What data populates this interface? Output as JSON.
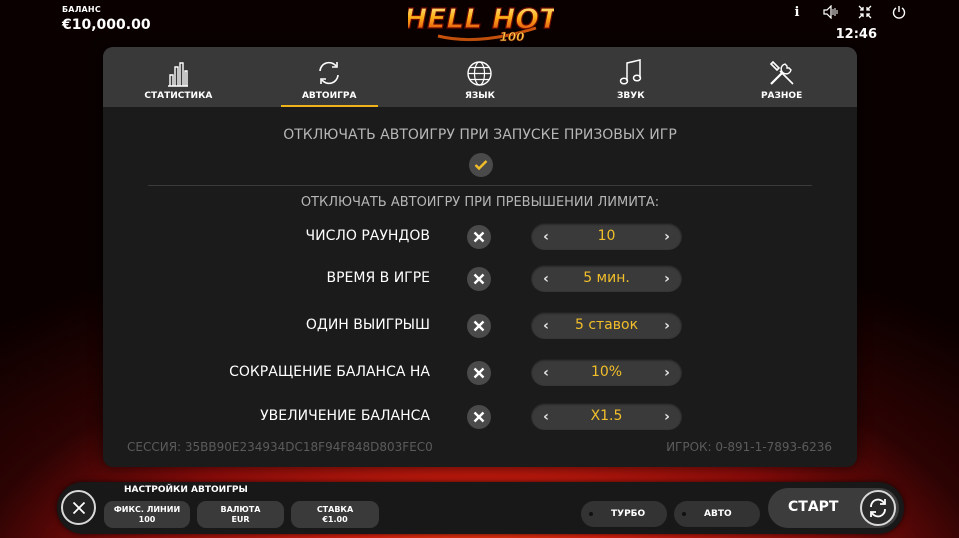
{
  "header": {
    "balance_label": "БАЛАНС",
    "balance_value": "€10,000.00",
    "logo_text": "HELL HOT",
    "logo_sub": "100",
    "info_icon_text": "i",
    "clock": "12:46"
  },
  "tabs": [
    {
      "label": "СТАТИСТИКА",
      "icon": "bar-chart-icon",
      "active": false
    },
    {
      "label": "АВТОИГРА",
      "icon": "refresh-icon",
      "active": true
    },
    {
      "label": "ЯЗЫК",
      "icon": "globe-icon",
      "active": false
    },
    {
      "label": "ЗВУК",
      "icon": "music-note-icon",
      "active": false
    },
    {
      "label": "РАЗНОЕ",
      "icon": "tools-icon",
      "active": false
    }
  ],
  "autoplay": {
    "prize_title": "ОТКЛЮЧАТЬ АВТОИГРУ ПРИ ЗАПУСКЕ ПРИЗОВЫХ ИГР",
    "prize_checked": true,
    "limit_title": "ОТКЛЮЧАТЬ АВТОИГРУ ПРИ ПРЕВЫШЕНИИ ЛИМИТА:",
    "rows": [
      {
        "label": "ЧИСЛО РАУНДОВ",
        "value": "10",
        "enabled": false
      },
      {
        "label": "ВРЕМЯ В ИГРЕ",
        "value": "5 мин.",
        "enabled": false
      },
      {
        "label": "ОДИН ВЫИГРЫШ",
        "value": "5 ставок",
        "enabled": false
      },
      {
        "label": "СОКРАЩЕНИЕ БАЛАНСА НА",
        "value": "10%",
        "enabled": false
      },
      {
        "label": "УВЕЛИЧЕНИЕ БАЛАНСА",
        "value": "X1.5",
        "enabled": false
      }
    ],
    "session": "СЕССИЯ: 35BB90E234934DC18F94F848D803FEC0",
    "player": "ИГРОК: 0-891-1-7893-6236"
  },
  "bottom": {
    "title": "НАСТРОЙКИ АВТОИГРЫ",
    "lines_label": "ФИКС. ЛИНИИ",
    "lines_value": "100",
    "currency_label": "ВАЛЮТА",
    "currency_value": "EUR",
    "bet_label": "СТАВКА",
    "bet_value": "€1.00",
    "turbo_label": "ТУРБО",
    "auto_label": "АВТО",
    "start_label": "СТАРТ"
  },
  "colors": {
    "accent": "#f0b21b",
    "value_text": "#f2bf2a",
    "panel_bg": "#1b1b1b",
    "tab_bg": "#393939"
  }
}
